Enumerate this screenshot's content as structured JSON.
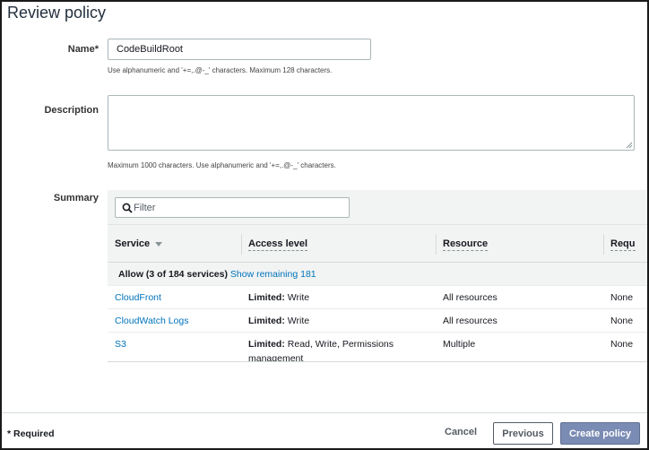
{
  "page": {
    "title": "Review policy"
  },
  "form": {
    "name_label": "Name*",
    "name_value": "CodeBuildRoot",
    "name_hint": "Use alphanumeric and '+=,.@-_' characters. Maximum 128 characters.",
    "description_label": "Description",
    "description_value": "",
    "description_hint": "Maximum 1000 characters. Use alphanumeric and '+=,.@-_' characters.",
    "summary_label": "Summary"
  },
  "summary": {
    "filter_placeholder": "Filter",
    "columns": [
      "Service",
      "Access level",
      "Resource",
      "Requ"
    ],
    "group": {
      "label": "Allow (3 of 184 services)",
      "link": "Show remaining 181"
    },
    "rows": [
      {
        "service": "CloudFront",
        "access_bold": "Limited:",
        "access_rest": "Write",
        "resource": "All resources",
        "request": "None"
      },
      {
        "service": "CloudWatch Logs",
        "access_bold": "Limited:",
        "access_rest": "Write",
        "resource": "All resources",
        "request": "None"
      },
      {
        "service": "S3",
        "access_bold": "Limited:",
        "access_rest": "Read, Write, Permissions management",
        "resource": "Multiple",
        "request": "None"
      }
    ]
  },
  "footer": {
    "required_note": "* Required",
    "cancel_label": "Cancel",
    "previous_label": "Previous",
    "create_label": "Create policy"
  },
  "colors": {
    "link": "#0073bb",
    "primary_button": "#7a8cb3",
    "table_header_bg": "#f2f3f3"
  }
}
